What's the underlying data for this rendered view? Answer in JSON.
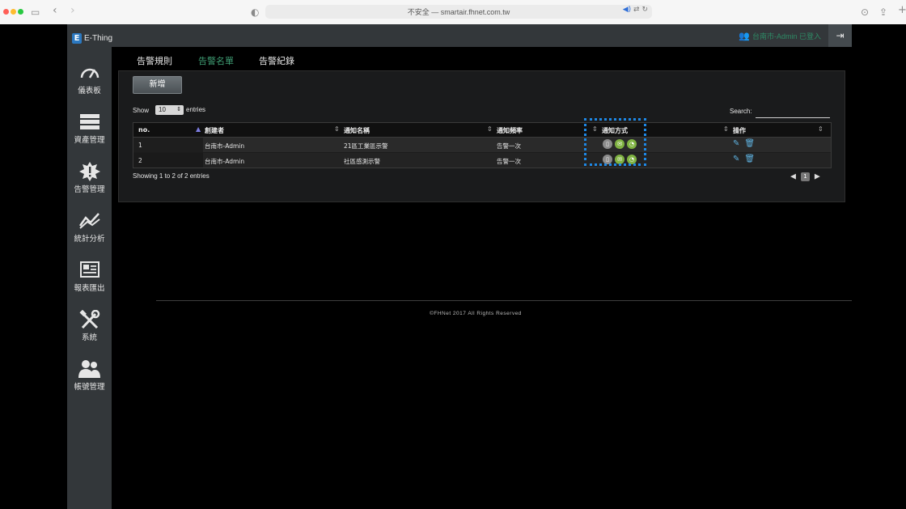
{
  "browser": {
    "url_text": "不安全 — smartair.fhnet.com.tw",
    "traffic_light_colors": [
      "#ff5f57",
      "#febc2e",
      "#28c840"
    ],
    "icons": [
      "sidebar-toggle-icon",
      "back-icon",
      "forward-icon",
      "shield-icon",
      "speaker-icon",
      "translate-icon",
      "reload-icon",
      "download-icon",
      "share-icon",
      "new-tab-icon"
    ]
  },
  "app": {
    "brand_letter": "E",
    "brand_name": "E-Thing",
    "user_status": "台南市-Admin 已登入",
    "accent_color": "#3f9e74"
  },
  "sidebar": {
    "items": [
      {
        "label": "儀表板",
        "icon": "speedometer-icon"
      },
      {
        "label": "資產管理",
        "icon": "list-icon"
      },
      {
        "label": "告警管理",
        "icon": "alert-badge-icon"
      },
      {
        "label": "統計分析",
        "icon": "trend-chart-icon"
      },
      {
        "label": "報表匯出",
        "icon": "newspaper-icon"
      },
      {
        "label": "系統",
        "icon": "tools-icon"
      },
      {
        "label": "帳號管理",
        "icon": "users-icon"
      }
    ]
  },
  "tabs": [
    {
      "label": "告警規則",
      "active": false
    },
    {
      "label": "告警名單",
      "active": true
    },
    {
      "label": "告警紀錄",
      "active": false
    }
  ],
  "panel": {
    "add_button": "新增",
    "show_label": "Show",
    "entries_label": "entries",
    "page_length": "10",
    "search_label": "Search:",
    "search_value": "",
    "info_text": "Showing 1 to 2 of 2 entries",
    "current_page": "1"
  },
  "table": {
    "headers": [
      "no.",
      "創建者",
      "通知名稱",
      "通知頻率",
      "通知方式",
      "操作"
    ],
    "rows": [
      {
        "no": "1",
        "creator": "台南市-Admin",
        "name": "21區工業區示警",
        "frequency": "告警一次",
        "methods": [
          "phone",
          "mail",
          "line"
        ]
      },
      {
        "no": "2",
        "creator": "台南市-Admin",
        "name": "社區感測示警",
        "frequency": "告警一次",
        "methods": [
          "phone",
          "mail",
          "line"
        ]
      }
    ]
  },
  "footer": {
    "text": "©FHNet 2017 All Rights Reserved"
  }
}
